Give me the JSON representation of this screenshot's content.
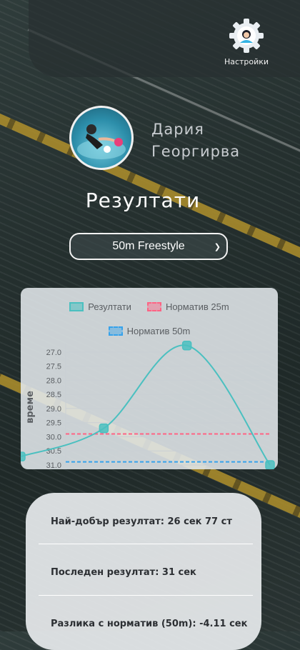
{
  "header": {
    "settings_label": "Настройки",
    "settings_icon": "gear-user-icon"
  },
  "profile": {
    "first_name": "Дария",
    "last_name": "Георгирва"
  },
  "page_title": "Резултати",
  "event_select": {
    "value": "50m Freestyle"
  },
  "chart_data": {
    "type": "line",
    "ylabel": "време",
    "y_reversed": true,
    "ylim": [
      26.7,
      31.0
    ],
    "yticks": [
      "27.0",
      "27.5",
      "28.0",
      "28.5",
      "29.0",
      "29.5",
      "30.0",
      "30.5",
      "31.0"
    ],
    "grid": true,
    "legend": {
      "position": "top",
      "entries": [
        "Резултати",
        "Норматив 25m",
        "Норматив 50m"
      ]
    },
    "series": [
      {
        "name": "Резултати",
        "color": "#4bc0c0",
        "values": [
          30.7,
          29.7,
          26.77,
          31.0
        ]
      },
      {
        "name": "Норматив 25m",
        "color": "#ff6384",
        "constant": 29.9
      },
      {
        "name": "Норматив 50m",
        "color": "#36a2eb",
        "constant": 30.89
      }
    ]
  },
  "stats": {
    "best": "Най-добър резултат: 26 сек 77 ст",
    "last": "Последен резултат: 31 сек",
    "diff": "Разлика с норматив (50m): -4.11 сек"
  }
}
